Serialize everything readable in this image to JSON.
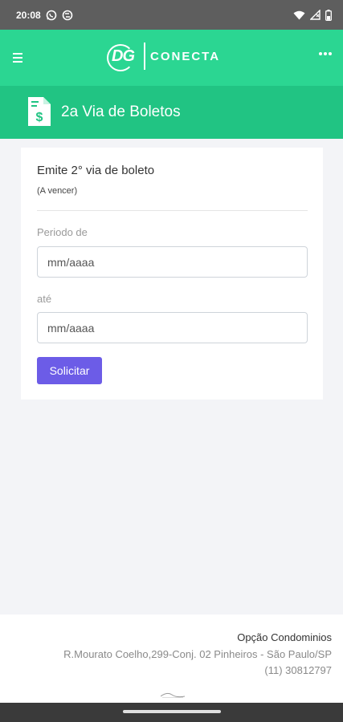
{
  "status_bar": {
    "time": "20:08",
    "left_icons": [
      "whatsapp-icon",
      "sync-icon"
    ],
    "right_icons": [
      "wifi-icon",
      "signal-icon",
      "battery-icon"
    ]
  },
  "header": {
    "logo_mark": "DG",
    "logo_text": "CONECTA",
    "menu_icon": "hamburger-icon",
    "more_icon": "more-dots-icon",
    "background_color": "#2bd692"
  },
  "title_bar": {
    "title": "2a Via de Boletos",
    "icon": "invoice-dollar-icon",
    "background_color": "#21c483"
  },
  "form": {
    "heading": "Emite 2° via de boleto",
    "subheading": "(A vencer)",
    "period_from_label": "Periodo de",
    "period_from_placeholder": "mm/aaaa",
    "period_to_label": "até",
    "period_to_placeholder": "mm/aaaa",
    "submit_label": "Solicitar",
    "submit_color": "#6c5ce7"
  },
  "footer": {
    "company": "Opção Condominios",
    "address": "R.Mourato Coelho,299-Conj. 02 Pinheiros - São Paulo/SP",
    "phone": "(11) 30812797"
  }
}
